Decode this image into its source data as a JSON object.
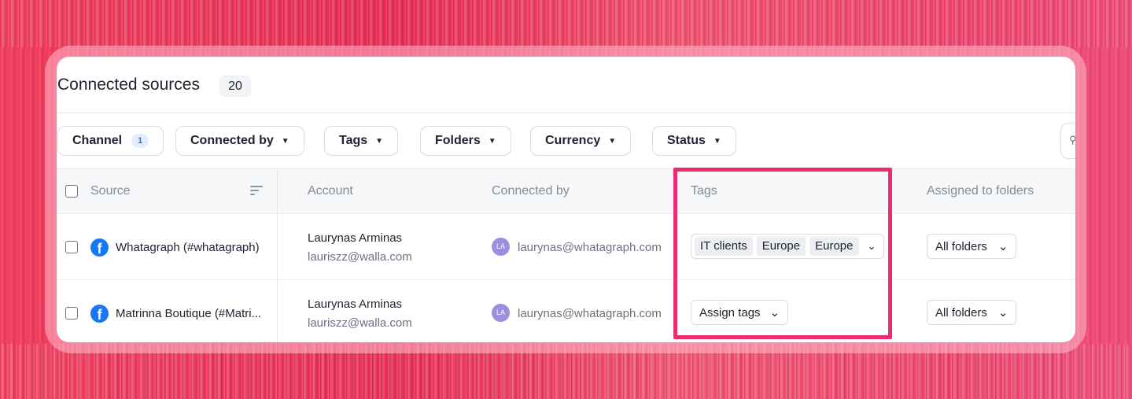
{
  "page": {
    "title": "Connected sources",
    "count": "20"
  },
  "filters": [
    {
      "label": "Channel",
      "badge": "1"
    },
    {
      "label": "Connected by"
    },
    {
      "label": "Tags"
    },
    {
      "label": "Folders"
    },
    {
      "label": "Currency"
    },
    {
      "label": "Status"
    }
  ],
  "table": {
    "headers": {
      "source": "Source",
      "account": "Account",
      "connected_by": "Connected by",
      "tags": "Tags",
      "folders": "Assigned to folders"
    },
    "rows": [
      {
        "source": "Whatagraph (#whatagraph)",
        "account_name": "Laurynas Arminas",
        "account_email": "lauriszz@walla.com",
        "avatar": "LA",
        "connected_by": "laurynas@whatagraph.com",
        "tags": [
          "IT clients",
          "Europe",
          "Europe"
        ],
        "folders": "All folders"
      },
      {
        "source": "Matrinna Boutique (#Matri...",
        "account_name": "Laurynas Arminas",
        "account_email": "lauriszz@walla.com",
        "avatar": "LA",
        "connected_by": "laurynas@whatagraph.com",
        "assign_tags": "Assign tags",
        "folders": "All folders"
      }
    ]
  },
  "icons": {
    "channel": "facebook-icon",
    "sort": "sort-icon",
    "search": "search-icon",
    "dropdown": "caret-down-icon"
  },
  "colors": {
    "highlight": "#ee2a72",
    "facebook": "#1877f2",
    "avatar": "#9b8fe0",
    "background": "#f0395e"
  }
}
